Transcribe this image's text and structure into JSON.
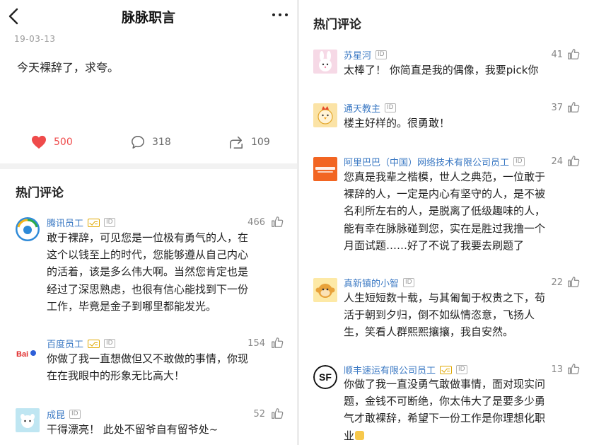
{
  "left": {
    "header": {
      "title": "脉脉职言",
      "back_icon": "chevron-left-icon",
      "more_icon": "more-dots-icon"
    },
    "post": {
      "date": "19-03-13",
      "body": "今天裸辞了，求夸。",
      "likes": "500",
      "comments": "318",
      "shares": "109",
      "like_color": "#ef4b4b"
    },
    "section_title": "热门评论",
    "comments": [
      {
        "name": "腾讯员工",
        "verified": true,
        "id_badge": "ID",
        "count": "466",
        "lines": [
          "敢于裸辞，可见您是一位极有勇气的人，在",
          "这个以钱至上的时代，您能够遵从自己内心",
          "的活着，该是多么伟大啊。当然您肯定也是",
          "经过了深思熟虑，也很有信心能找到下一份",
          "工作，毕竟是金子到哪里都能发光。"
        ]
      },
      {
        "name": "百度员工",
        "verified": true,
        "id_badge": "ID",
        "count": "154",
        "avatar_text": "Bai",
        "lines": [
          "你做了我一直想做但又不敢做的事情，你现",
          "在在我眼中的形象无比高大！"
        ]
      },
      {
        "name": "成昆",
        "verified": false,
        "id_badge": "ID",
        "count": "52",
        "lines": [
          "干得漂亮！ 此处不留爷自有留爷处~"
        ]
      }
    ]
  },
  "right": {
    "section_title": "热门评论",
    "comments": [
      {
        "name": "苏星河",
        "id_badge": "ID",
        "count": "41",
        "lines": [
          "太棒了！ 你简直是我的偶像，我要pick你"
        ]
      },
      {
        "name": "通天教主",
        "id_badge": "ID",
        "count": "37",
        "lines": [
          "楼主好样的。很勇敢！"
        ]
      },
      {
        "name": "阿里巴巴（中国）网络技术有限公司员工",
        "id_badge": "ID",
        "count": "24",
        "lines": [
          "您真是我辈之楷模，世人之典范，一位敢于",
          "裸辞的人，一定是内心有坚守的人，是不被",
          "名利所左右的人，是脱离了低级趣味的人，",
          "能有幸在脉脉碰到您，实在是胜过我撸一个",
          "月面试题……好了不说了我要去刷题了"
        ]
      },
      {
        "name": "真新镇的小智",
        "id_badge": "ID",
        "count": "22",
        "lines": [
          "人生短短数十载，与其匍匐于权贵之下，苟",
          "活于朝到夕归，倒不如纵情恣意，飞扬人",
          "生，笑看人群熙熙攘攘，我自安然。"
        ]
      },
      {
        "name": "顺丰速运有限公司员工",
        "verified": true,
        "id_badge": "ID",
        "count": "13",
        "avatar_text": "SF",
        "lines": [
          "你做了我一直没勇气敢做事情，面对现实问",
          "题，金钱不可断绝，你太伟大了是要多少勇",
          "气才敢裸辞，希望下一份工作是你理想化职",
          "业"
        ]
      }
    ]
  }
}
